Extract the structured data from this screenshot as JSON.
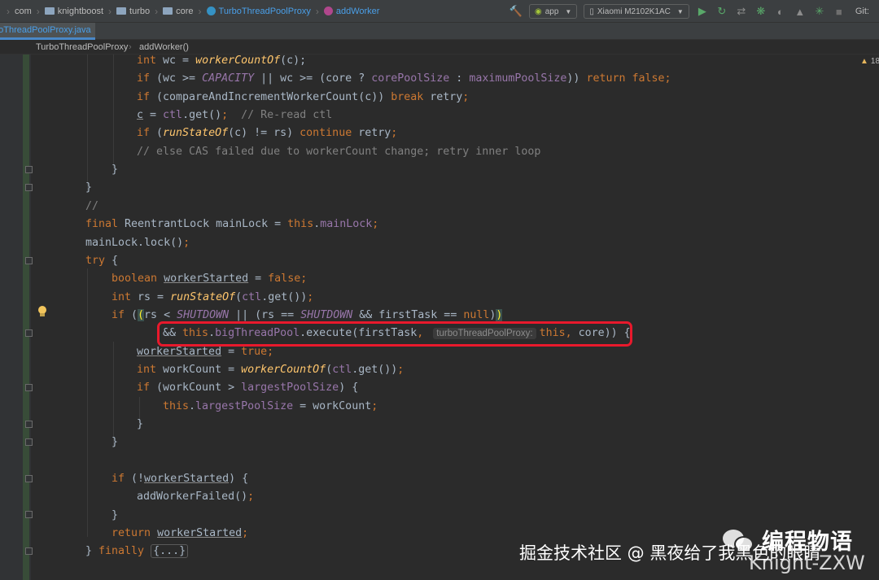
{
  "navbar": {
    "breadcrumbs": [
      {
        "label": "com",
        "icon": "folder-icon"
      },
      {
        "label": "knightboost",
        "icon": "folder-icon"
      },
      {
        "label": "turbo",
        "icon": "folder-icon"
      },
      {
        "label": "core",
        "icon": "folder-icon"
      },
      {
        "label": "TurboThreadPoolProxy",
        "icon": "class-icon"
      },
      {
        "label": "addWorker",
        "icon": "method-icon"
      }
    ],
    "run_config": "app",
    "device": "Xiaomi M2102K1AC",
    "git_label": "Git:"
  },
  "tab": {
    "file_name": "TurboThreadPoolProxy.java",
    "visible_text": "boThreadPoolProxy.java"
  },
  "structure": {
    "class_name": "TurboThreadPoolProxy",
    "method_name": "addWorker()"
  },
  "editor": {
    "warning_count": "18",
    "code_lines": [
      [
        {
          "t": "int",
          "s": "k"
        },
        {
          "t": " wc = "
        },
        {
          "t": "workerCountOf",
          "s": "f"
        },
        {
          "t": "(c);"
        }
      ],
      [
        {
          "t": "if",
          "s": "k"
        },
        {
          "t": " (wc >= "
        },
        {
          "t": "CAPACITY",
          "s": "mi"
        },
        {
          "t": " || wc >= (core ? "
        },
        {
          "t": "corePoolSize",
          "s": "m"
        },
        {
          "t": " : "
        },
        {
          "t": "maximumPoolSize",
          "s": "m"
        },
        {
          "t": ")) "
        },
        {
          "t": "return false",
          "s": "k"
        },
        {
          "t": ";",
          "s": "k"
        }
      ],
      [
        {
          "t": "if",
          "s": "k"
        },
        {
          "t": " (compareAndIncrementWorkerCount(c)) "
        },
        {
          "t": "break",
          "s": "k"
        },
        {
          "t": " retry"
        },
        {
          "t": ";",
          "s": "k"
        }
      ],
      [
        {
          "t": "c",
          "s": "u"
        },
        {
          "t": " = "
        },
        {
          "t": "ctl",
          "s": "m"
        },
        {
          "t": ".get()"
        },
        {
          "t": ";",
          "s": "k"
        },
        {
          "t": "  // Re-read ctl",
          "s": "c"
        }
      ],
      [
        {
          "t": "if",
          "s": "k"
        },
        {
          "t": " ("
        },
        {
          "t": "runStateOf",
          "s": "f"
        },
        {
          "t": "(c) != rs) "
        },
        {
          "t": "continue",
          "s": "k"
        },
        {
          "t": " retry"
        },
        {
          "t": ";",
          "s": "k"
        }
      ],
      [
        {
          "t": "// else CAS failed due to workerCount change; retry inner loop",
          "s": "c"
        }
      ],
      [
        {
          "t": "}"
        }
      ],
      [
        {
          "t": "}"
        }
      ],
      [
        {
          "t": "//",
          "s": "c"
        }
      ],
      [
        {
          "t": "final",
          "s": "k"
        },
        {
          "t": " ReentrantLock mainLock = "
        },
        {
          "t": "this",
          "s": "k"
        },
        {
          "t": "."
        },
        {
          "t": "mainLock",
          "s": "m"
        },
        {
          "t": ";",
          "s": "k"
        }
      ],
      [
        {
          "t": "mainLock.lock()"
        },
        {
          "t": ";",
          "s": "k"
        }
      ],
      [
        {
          "t": "try",
          "s": "k"
        },
        {
          "t": " {"
        }
      ],
      [
        {
          "t": "boolean",
          "s": "k"
        },
        {
          "t": " "
        },
        {
          "t": "workerStarted",
          "s": "u"
        },
        {
          "t": " = "
        },
        {
          "t": "false",
          "s": "k"
        },
        {
          "t": ";",
          "s": "k"
        }
      ],
      [
        {
          "t": "int",
          "s": "k"
        },
        {
          "t": " rs = "
        },
        {
          "t": "runStateOf",
          "s": "f"
        },
        {
          "t": "("
        },
        {
          "t": "ctl",
          "s": "m"
        },
        {
          "t": ".get())"
        },
        {
          "t": ";",
          "s": "k"
        }
      ],
      [
        {
          "t": "if",
          "s": "k"
        },
        {
          "t": " ("
        },
        {
          "t": "(",
          "s": "hl-paren"
        },
        {
          "t": "rs < "
        },
        {
          "t": "SHUTDOWN",
          "s": "mi"
        },
        {
          "t": " || (rs == "
        },
        {
          "t": "SHUTDOWN",
          "s": "mi"
        },
        {
          "t": " && firstTask == "
        },
        {
          "t": "null",
          "s": "k"
        },
        {
          "t": ")"
        },
        {
          "t": ")",
          "s": "hl-paren"
        }
      ],
      [
        {
          "t": "&& "
        },
        {
          "t": "this",
          "s": "k"
        },
        {
          "t": "."
        },
        {
          "t": "bigThreadPool",
          "s": "m"
        },
        {
          "t": ".execute(firstTask"
        },
        {
          "t": ",",
          "s": "k"
        },
        {
          "t": " "
        },
        {
          "t": "turboThreadPoolProxy:",
          "s": "hint"
        },
        {
          "t": "this",
          "s": "k"
        },
        {
          "t": ", ",
          "s": "k"
        },
        {
          "t": "core)) {"
        }
      ],
      [
        {
          "t": "workerStarted",
          "s": "u"
        },
        {
          "t": " = "
        },
        {
          "t": "true",
          "s": "k"
        },
        {
          "t": ";",
          "s": "k"
        }
      ],
      [
        {
          "t": "int",
          "s": "k"
        },
        {
          "t": " workCount = "
        },
        {
          "t": "workerCountOf",
          "s": "f"
        },
        {
          "t": "("
        },
        {
          "t": "ctl",
          "s": "m"
        },
        {
          "t": ".get())"
        },
        {
          "t": ";",
          "s": "k"
        }
      ],
      [
        {
          "t": "if",
          "s": "k"
        },
        {
          "t": " (workCount > "
        },
        {
          "t": "largestPoolSize",
          "s": "m"
        },
        {
          "t": ") {"
        }
      ],
      [
        {
          "t": "this",
          "s": "k"
        },
        {
          "t": "."
        },
        {
          "t": "largestPoolSize",
          "s": "m"
        },
        {
          "t": " = workCount"
        },
        {
          "t": ";",
          "s": "k"
        }
      ],
      [
        {
          "t": "}"
        }
      ],
      [
        {
          "t": "}"
        }
      ],
      [
        {
          "t": ""
        }
      ],
      [
        {
          "t": "if",
          "s": "k"
        },
        {
          "t": " (!"
        },
        {
          "t": "workerStarted",
          "s": "u"
        },
        {
          "t": ") {"
        }
      ],
      [
        {
          "t": "addWorkerFailed()"
        },
        {
          "t": ";",
          "s": "k"
        }
      ],
      [
        {
          "t": "}"
        }
      ],
      [
        {
          "t": "return",
          "s": "k"
        },
        {
          "t": " "
        },
        {
          "t": "workerStarted",
          "s": "u"
        },
        {
          "t": ";",
          "s": "k"
        }
      ],
      [
        {
          "t": "} "
        },
        {
          "t": "finally",
          "s": "k"
        },
        {
          "t": " "
        },
        {
          "t": "{...}",
          "s": "folded"
        }
      ]
    ]
  },
  "watermarks": {
    "wechat_account": "编程物语",
    "juejin": "掘金技术社区 @ 黑夜给了我黑色的眼睛",
    "author": "Knight-ZXW"
  },
  "colors": {
    "editor_bg": "#2b2b2b",
    "keyword": "#cc7832",
    "field": "#9876aa",
    "method_decl": "#ffc66d",
    "comment": "#808080",
    "highlight_box": "#e8192c",
    "link_blue": "#4a9fe8"
  }
}
